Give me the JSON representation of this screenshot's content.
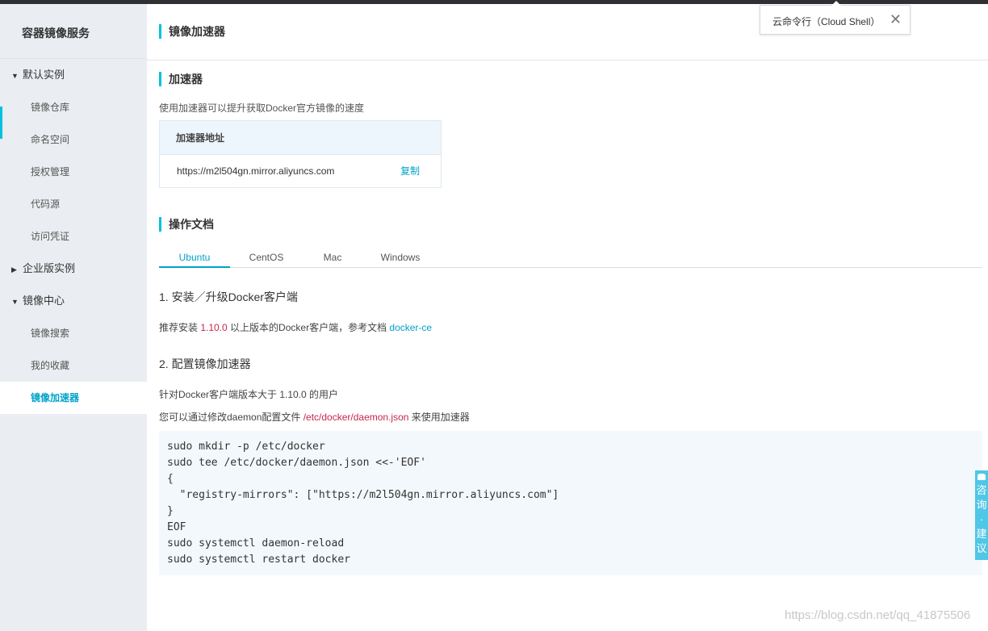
{
  "sidebar": {
    "title": "容器镜像服务",
    "groups": [
      {
        "label": "默认实例",
        "caret": "▼",
        "items": [
          "镜像仓库",
          "命名空间",
          "授权管理",
          "代码源",
          "访问凭证"
        ]
      },
      {
        "label": "企业版实例",
        "caret": "▶",
        "items": []
      },
      {
        "label": "镜像中心",
        "caret": "▼",
        "items": [
          "镜像搜索",
          "我的收藏",
          "镜像加速器"
        ]
      }
    ],
    "active_item": "镜像加速器"
  },
  "header": {
    "title": "镜像加速器"
  },
  "accelerator": {
    "title": "加速器",
    "description": "使用加速器可以提升获取Docker官方镜像的速度",
    "table_header": "加速器地址",
    "address": "https://m2l504gn.mirror.aliyuncs.com",
    "copy_label": "复制"
  },
  "docs": {
    "title": "操作文档",
    "tabs": [
      "Ubuntu",
      "CentOS",
      "Mac",
      "Windows"
    ],
    "active_tab": "Ubuntu",
    "step1": {
      "title": "1. 安装／升级Docker客户端",
      "text_before": "推荐安装 ",
      "version": "1.10.0",
      "text_middle": " 以上版本的Docker客户端，参考文档 ",
      "link": "docker-ce"
    },
    "step2": {
      "title": "2. 配置镜像加速器",
      "line1": "针对Docker客户端版本大于 1.10.0 的用户",
      "line2_before": "您可以通过修改daemon配置文件 ",
      "line2_path": "/etc/docker/daemon.json",
      "line2_after": " 来使用加速器"
    },
    "code": [
      "sudo mkdir -p /etc/docker",
      "sudo tee /etc/docker/daemon.json <<-'EOF'",
      "{",
      "  \"registry-mirrors\": [\"https://m2l504gn.mirror.aliyuncs.com\"]",
      "}",
      "EOF",
      "sudo systemctl daemon-reload",
      "sudo systemctl restart docker"
    ]
  },
  "cloud_shell": {
    "label": "云命令行（Cloud Shell）",
    "close_icon": "close-icon"
  },
  "feedback": {
    "chars": [
      "咨",
      "询",
      "·",
      "建",
      "议"
    ]
  },
  "watermark": "https://blog.csdn.net/qq_41875506",
  "colors": {
    "accent": "#00c1de",
    "link": "#00a2ca",
    "highlight": "#c7254e",
    "sidebar_bg": "#eaedf1"
  }
}
